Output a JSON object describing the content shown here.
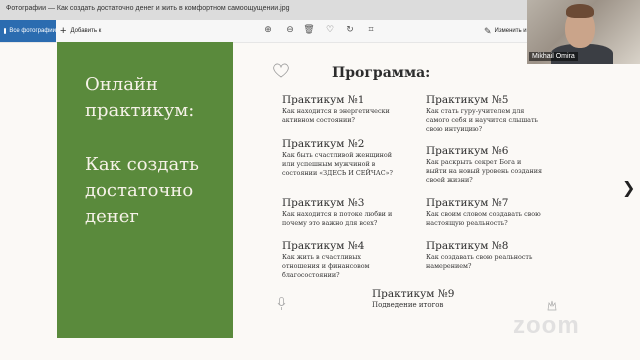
{
  "window": {
    "title": "Фотографии — Как создать достаточно денег и жить в комфортном самоощущении.jpg"
  },
  "toolbar": {
    "home_label": "Все фотографии",
    "add_label": "Добавить к",
    "edit_label": "Изменить и с"
  },
  "slide": {
    "left_title": "Онлайн практикум:",
    "left_subtitle": "Как создать достаточно денег",
    "program_title": "Программа:",
    "practicums": [
      {
        "heading": "Практикум №1",
        "desc": "Как находится в энергетически активном состоянии?"
      },
      {
        "heading": "Практикум №2",
        "desc": "Как быть счастливой женщиной или успешным мужчиной в состоянии «ЗДЕСЬ И СЕЙЧАС»?"
      },
      {
        "heading": "Практикум №3",
        "desc": "Как находится в потоке любви и почему это важно для всех?"
      },
      {
        "heading": "Практикум №4",
        "desc": "Как жить в счастливых отношения и финансовом благосостоянии?"
      },
      {
        "heading": "Практикум №5",
        "desc": "Как стать гуру-учителем для самого себя и научится слышать свою интуицию?"
      },
      {
        "heading": "Практикум №6",
        "desc": "Как раскрыть секрет Бога и выйти на новый уровень создания своей жизни?"
      },
      {
        "heading": "Практикум №7",
        "desc": "Как своим словом создавать свою настоящую реальность?"
      },
      {
        "heading": "Практикум №8",
        "desc": "Как создавать свою реальность намерением?"
      },
      {
        "heading": "Практикум №9",
        "desc": "Подведение итогов"
      }
    ]
  },
  "participant": {
    "name": "Mikhail Omira"
  },
  "watermark": "zoom"
}
